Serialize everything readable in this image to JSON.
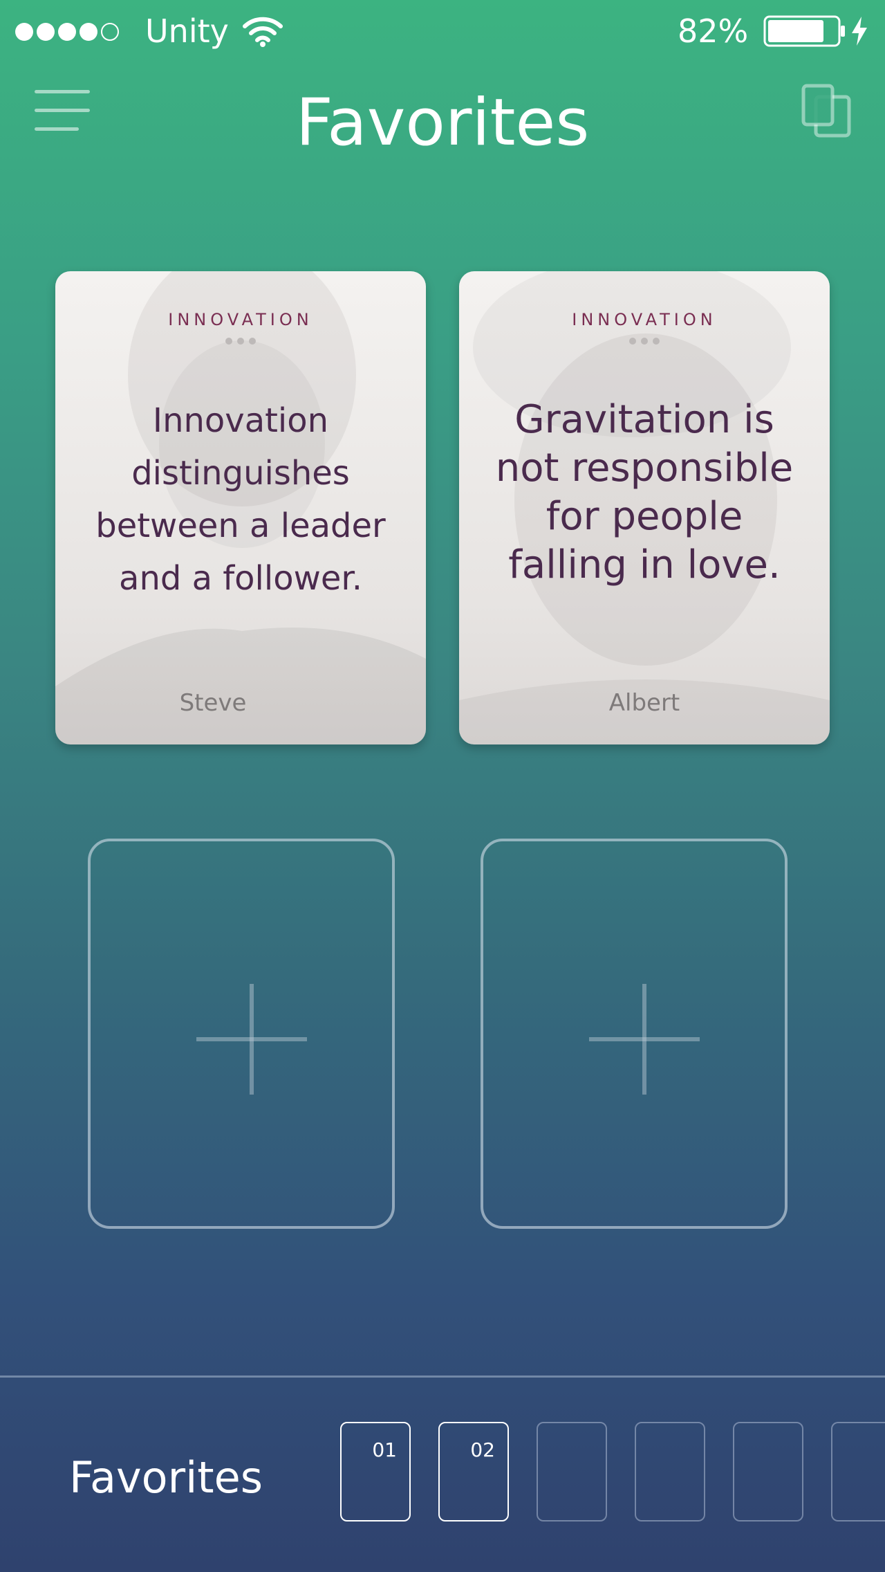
{
  "status_bar": {
    "carrier": "Unity",
    "battery_percent": "82%",
    "battery_level": 0.82,
    "signal_bars_filled": 4,
    "signal_bars_total": 5
  },
  "header": {
    "title": "Favorites",
    "menu_icon": "hamburger-menu-icon",
    "right_icon": "card-stack-icon"
  },
  "cards": [
    {
      "category": "INNOVATION",
      "quote": "Innovation distinguishes between a leader and a follower.",
      "author": "Steve"
    },
    {
      "category": "INNOVATION",
      "quote": "Gravitation is not responsible for people falling in love.",
      "author": "Albert"
    }
  ],
  "add_slots": [
    {
      "icon": "plus-icon"
    },
    {
      "icon": "plus-icon"
    }
  ],
  "bottom_bar": {
    "label": "Favorites",
    "tiles": [
      {
        "number": "01",
        "filled": true
      },
      {
        "number": "02",
        "filled": true
      },
      {
        "number": "",
        "filled": false
      },
      {
        "number": "",
        "filled": false
      },
      {
        "number": "",
        "filled": false
      },
      {
        "number": "",
        "filled": false
      }
    ]
  },
  "colors": {
    "gradient_top": "#3cb381",
    "gradient_bottom": "#2f426e",
    "card_category": "#7a2e52",
    "quote_text": "#4a2a4d",
    "author_text": "#7e7a7a"
  }
}
